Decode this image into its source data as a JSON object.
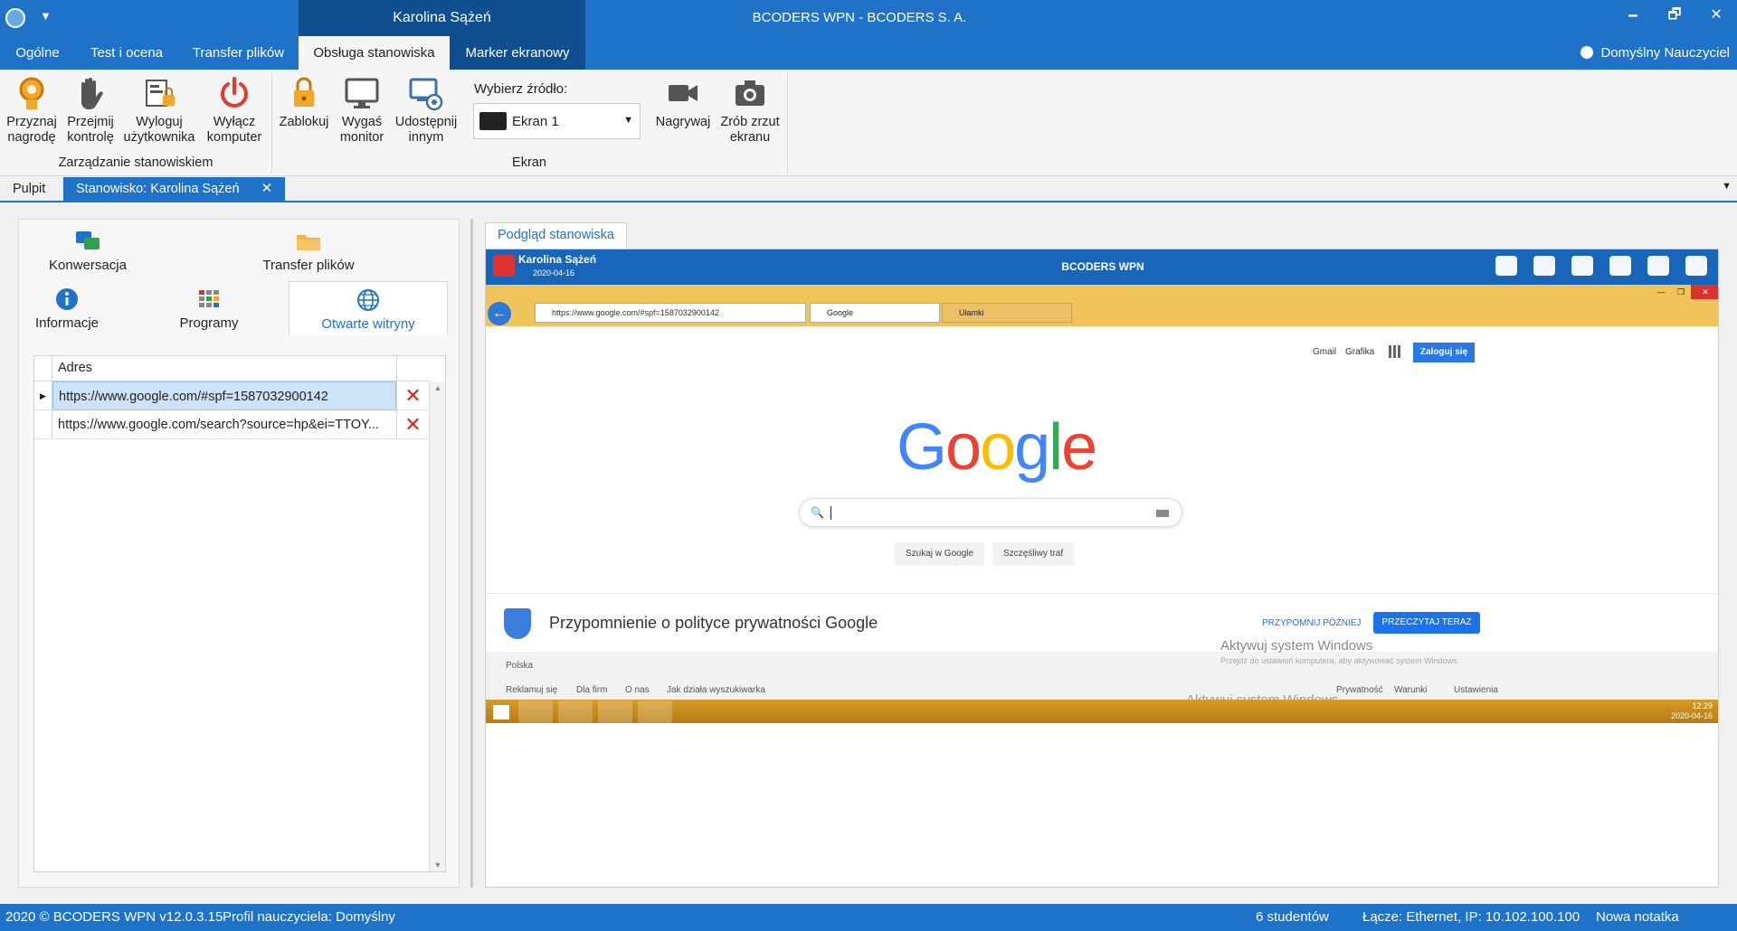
{
  "window": {
    "active_user": "Karolina Sążeń",
    "title": "BCODERS WPN - BCODERS S. A.",
    "minimize": "🗕",
    "restore": "🗗",
    "close": "✕"
  },
  "ribbon_tabs": [
    "Ogólne",
    "Test i ocena",
    "Transfer plików",
    "Obsługa stanowiska",
    "Marker ekranowy"
  ],
  "teacher_label": "Domyślny Nauczyciel",
  "ribbon": {
    "manage_group": {
      "label": "Zarządzanie stanowiskiem",
      "buttons": [
        {
          "line1": "Przyznaj",
          "line2": "nagrodę",
          "icon": "award-icon"
        },
        {
          "line1": "Przejmij",
          "line2": "kontrolę",
          "icon": "hand-icon"
        },
        {
          "line1": "Wyloguj",
          "line2": "użytkownika",
          "icon": "logout-user-icon"
        },
        {
          "line1": "Wyłącz",
          "line2": "komputer",
          "icon": "power-icon"
        }
      ]
    },
    "screen_group": {
      "label": "Ekran",
      "buttons": [
        {
          "line1": "Zablokuj",
          "line2": "",
          "icon": "lock-icon"
        },
        {
          "line1": "Wygaś",
          "line2": "monitor",
          "icon": "monitor-icon"
        },
        {
          "line1": "Udostępnij",
          "line2": "innym",
          "icon": "share-screen-icon"
        },
        {
          "line1": "Nagrywaj",
          "line2": "",
          "icon": "video-camera-icon"
        },
        {
          "line1": "Zrób zrzut",
          "line2": "ekranu",
          "icon": "photo-camera-icon"
        }
      ],
      "source_label": "Wybierz źródło:",
      "source_value": "Ekran 1"
    }
  },
  "doc_tabs": [
    "Pulpit",
    "Stanowisko: Karolina Sążeń"
  ],
  "left": {
    "tiles": [
      "Konwersacja",
      "Transfer plików",
      "Informacje",
      "Programy",
      "Otwarte witryny"
    ],
    "grid": {
      "column": "Adres",
      "rows": [
        "https://www.google.com/#spf=1587032900142",
        "https://www.google.com/search?source=hp&ei=TTOY..."
      ]
    }
  },
  "preview": {
    "tab": "Podgląd stanowiska",
    "remote": {
      "user": "Karolina Sążeń",
      "date": "2020-04-16",
      "app": "BCODERS WPN",
      "address": "https://www.google.com/#spf=1587032900142",
      "tab1": "Google",
      "tab2": "Ułamki",
      "links": [
        "Gmail",
        "Grafika"
      ],
      "signin": "Zaloguj się",
      "search_btn": "Szukaj w Google",
      "lucky_btn": "Szczęśliwy traf",
      "policy": "Przypomnienie o polityce prywatności Google",
      "remind_later": "PRZYPOMNIJ PÓŹNIEJ",
      "read_now": "PRZECZYTAJ TERAZ",
      "country": "Polska",
      "footer_left": [
        "Reklamuj się",
        "Dla firm",
        "O nas",
        "Jak działa wyszukiwarka"
      ],
      "footer_right": [
        "Prywatność",
        "Warunki",
        "Ustawienia"
      ],
      "activate": "Aktywuj system Windows",
      "activate_sub": "Przejdź do ustawień komputera, aby aktywować system Windows.",
      "clock_time": "12:29",
      "clock_date": "2020-04-16"
    }
  },
  "status": {
    "left": "2020 ©  BCODERS WPN v12.0.3.15",
    "profile": "Profil nauczyciela: Domyślny",
    "students": "6 studentów",
    "network": "Łącze: Ethernet, IP: 10.102.100.100",
    "note": "Nowa notatka"
  },
  "colors": {
    "accent": "#1e73c8",
    "dark_tab": "#0f4f8f",
    "delete": "#dd2222"
  }
}
